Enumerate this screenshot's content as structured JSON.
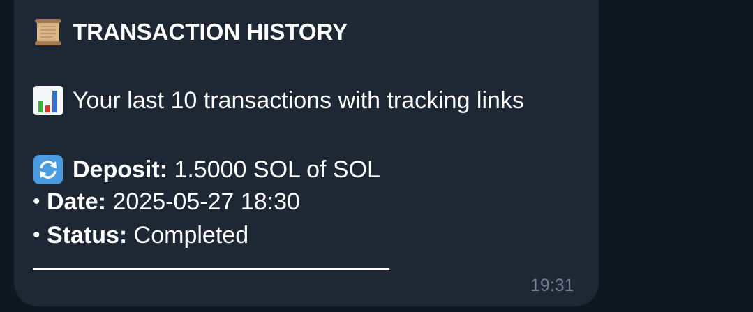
{
  "message": {
    "title": "TRANSACTION HISTORY",
    "title_icon": "scroll-icon",
    "subtitle": "Your last 10 transactions with tracking links",
    "subtitle_icon": "bar-chart-icon",
    "transaction": {
      "icon": "refresh-icon",
      "deposit_label": "Deposit:",
      "deposit_value": " 1.5000 SOL of SOL",
      "date_bullet": "•",
      "date_label": "Date:",
      "date_value": " 2025-05-27 18:30",
      "status_bullet": "•",
      "status_label": "Status:",
      "status_value": " Completed"
    },
    "timestamp": "19:31"
  },
  "colors": {
    "chat_background": "#0f1720",
    "bubble_background": "#1e2734",
    "text": "#ffffff",
    "timestamp": "#6f7f90"
  }
}
